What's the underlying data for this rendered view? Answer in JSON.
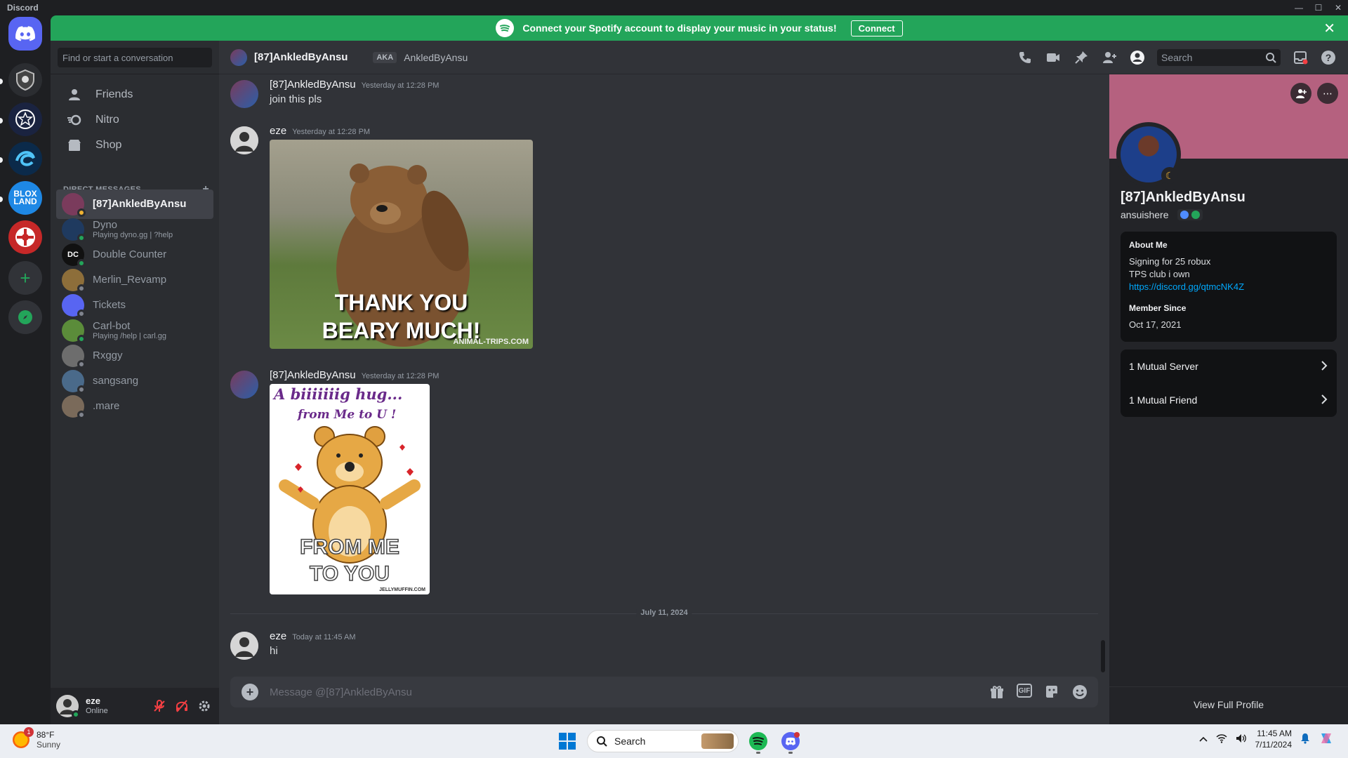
{
  "window": {
    "title": "Discord",
    "controls": [
      "—",
      "☐",
      "✕"
    ]
  },
  "banner": {
    "message": "Connect your Spotify account to display your music in your status!",
    "connect_label": "Connect",
    "close": "✕",
    "color": "#23a55a"
  },
  "servers": [
    {
      "name": "Direct Messages",
      "icon": "discord-logo",
      "color": "#5865f2"
    },
    {
      "name": "server-1",
      "color": "#2b2d31"
    },
    {
      "name": "server-2",
      "color": "#1a2340"
    },
    {
      "name": "server-3",
      "color": "#0b2a4a"
    },
    {
      "name": "server-4",
      "label": "BLOX LAND",
      "color": "#1e88e5"
    },
    {
      "name": "server-5",
      "color": "#c62828"
    },
    {
      "name": "Add a Server",
      "icon": "plus-icon",
      "color": "#313338"
    },
    {
      "name": "Explore",
      "icon": "compass-icon",
      "color": "#313338"
    }
  ],
  "sidebar": {
    "search_placeholder": "Find or start a conversation",
    "nav": [
      {
        "label": "Friends",
        "icon": "friends-icon"
      },
      {
        "label": "Nitro",
        "icon": "nitro-icon"
      },
      {
        "label": "Shop",
        "icon": "shop-icon"
      }
    ],
    "dm_header": "DIRECT MESSAGES",
    "dm_add": "+",
    "dms": [
      {
        "name": "[87]AnkledByAnsu",
        "sub": "",
        "status": "idle",
        "color": "#7a3b5c",
        "active": true
      },
      {
        "name": "Dyno",
        "sub": "Playing dyno.gg | ?help",
        "status": "online",
        "color": "#1f3a5f"
      },
      {
        "name": "Double Counter",
        "sub": "",
        "status": "online",
        "color": "#111111",
        "initials": "DC"
      },
      {
        "name": "Merlin_Revamp",
        "sub": "",
        "status": "offline",
        "color": "#8d6e3a"
      },
      {
        "name": "Tickets",
        "sub": "",
        "status": "offline",
        "color": "#5865f2"
      },
      {
        "name": "Carl-bot",
        "sub": "Playing /help | carl.gg",
        "status": "online",
        "color": "#5b8c3a"
      },
      {
        "name": "Rxggy",
        "sub": "",
        "status": "offline",
        "color": "#6d6d6d"
      },
      {
        "name": "sangsang",
        "sub": "",
        "status": "offline",
        "color": "#4a6a8a"
      },
      {
        "name": ".mare",
        "sub": "",
        "status": "offline",
        "color": "#7a6a5a"
      }
    ]
  },
  "user_panel": {
    "name": "eze",
    "status": "Online"
  },
  "chat_header": {
    "name": "[87]AnkledByAnsu",
    "aka": "AKA",
    "aka_name": "AnkledByAnsu",
    "search_placeholder": "Search"
  },
  "messages": [
    {
      "author": "[87]AnkledByAnsu",
      "time": "Yesterday at 12:28 PM",
      "text": "join this pls"
    },
    {
      "author": "eze",
      "time": "Yesterday at 12:28 PM",
      "gif_caption_1": "THANK YOU",
      "gif_caption_2": "BEARY MUCH!",
      "gif_watermark": "ANIMAL-TRIPS.COM"
    },
    {
      "author": "[87]AnkledByAnsu",
      "time": "Yesterday at 12:28 PM",
      "gif_title_1": "A biiiiiiig hug...",
      "gif_title_2": "from Me to U !",
      "gif_caption_1": "FROM ME",
      "gif_caption_2": "TO YOU",
      "gif_watermark": "JELLYMUFFIN.COM"
    },
    {
      "author": "eze",
      "time": "Today at 11:45 AM",
      "text": "hi"
    }
  ],
  "date_divider": "July 11, 2024",
  "composer": {
    "placeholder": "Message @[87]AnkledByAnsu",
    "gif_label": "GIF"
  },
  "profile": {
    "display_name": "[87]AnkledByAnsu",
    "username": "ansuishere",
    "banner_color": "#b5617f",
    "about_title": "About Me",
    "about_lines": [
      "Signing for 25 robux",
      "TPS club i own"
    ],
    "about_link": "https://discord.gg/qtmcNK4Z",
    "member_since_title": "Member Since",
    "member_since": "Oct 17, 2021",
    "mutual_server": "1 Mutual Server",
    "mutual_friend": "1 Mutual Friend",
    "view_full": "View Full Profile"
  },
  "taskbar": {
    "weather_temp": "88°F",
    "weather_desc": "Sunny",
    "weather_badge": "1",
    "search_label": "Search",
    "time": "11:45 AM",
    "date": "7/11/2024"
  }
}
